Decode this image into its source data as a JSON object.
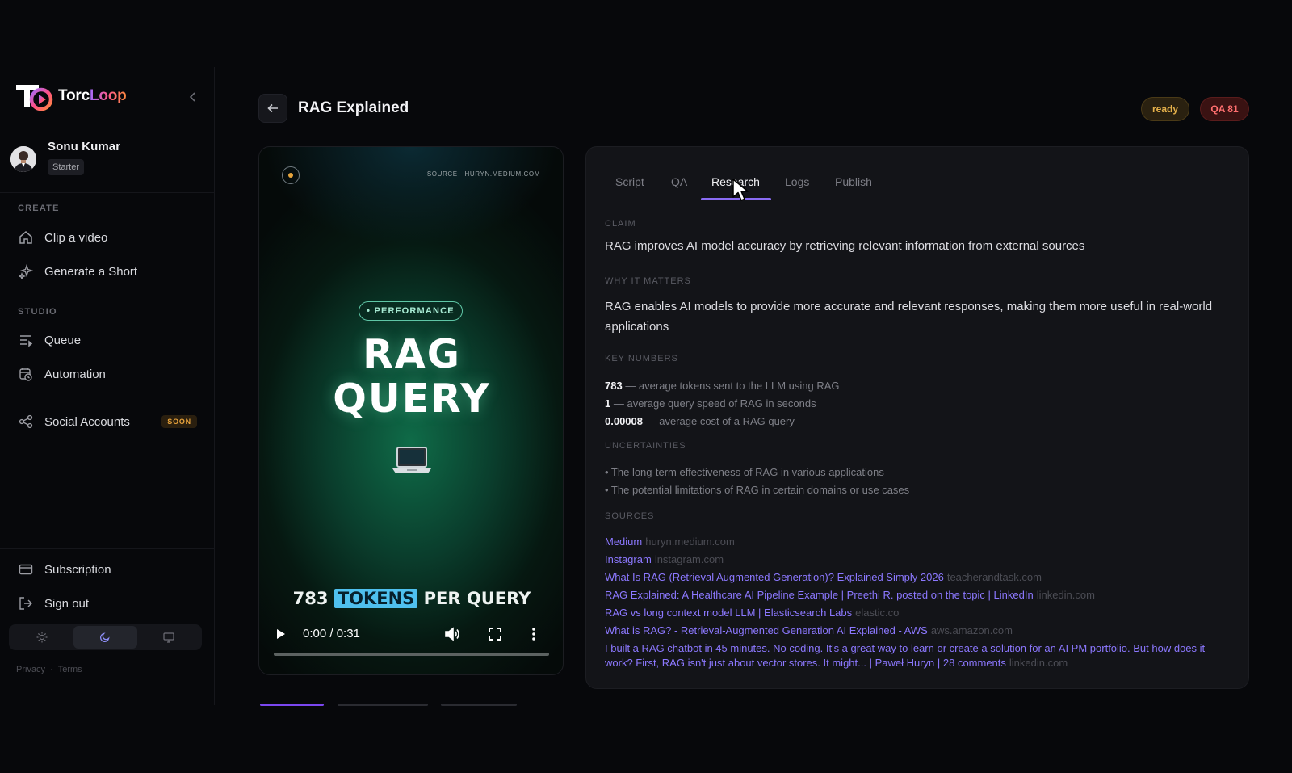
{
  "brand": {
    "part1": "Torc",
    "part2": "Loop",
    "logo_icon": "torcloop-logo-icon",
    "collapse_icon": "chevron-left-icon"
  },
  "user": {
    "name": "Sonu Kumar",
    "plan": "Starter",
    "avatar_icon": "user-avatar-icon"
  },
  "sidebar": {
    "create_label": "CREATE",
    "create_items": [
      {
        "label": "Clip a video",
        "icon": "home-icon"
      },
      {
        "label": "Generate a Short",
        "icon": "sparkles-icon"
      }
    ],
    "studio_label": "STUDIO",
    "studio_items": [
      {
        "label": "Queue",
        "icon": "queue-list-icon"
      },
      {
        "label": "Automation",
        "icon": "calendar-clock-icon"
      }
    ],
    "social": {
      "label": "Social Accounts",
      "badge": "SOON",
      "icon": "share-icon"
    },
    "bottom_items": [
      {
        "label": "Subscription",
        "icon": "credit-card-icon"
      },
      {
        "label": "Sign out",
        "icon": "sign-out-icon"
      }
    ],
    "theme_options": [
      {
        "icon": "sun-icon",
        "active": false
      },
      {
        "icon": "moon-icon",
        "active": true
      },
      {
        "icon": "monitor-icon",
        "active": false
      }
    ],
    "legal": {
      "privacy": "Privacy",
      "separator": "·",
      "terms": "Terms"
    }
  },
  "header": {
    "title": "RAG Explained",
    "status_badge": "ready",
    "qa_badge": "QA 81",
    "back_icon": "arrow-left-icon"
  },
  "video": {
    "source": "SOURCE · HURYN.MEDIUM.COM",
    "tag": "• PERFORMANCE",
    "headline_line1": "RAG",
    "headline_line2": "QUERY",
    "emoji_icon": "laptop-icon",
    "caption_number": "783",
    "caption_highlight": "TOKENS",
    "caption_rest": "PER QUERY",
    "time": "0:00 / 0:31",
    "progress": 0.0,
    "controls": [
      "play-icon",
      "volume-icon",
      "fullscreen-icon",
      "more-vertical-icon"
    ]
  },
  "tabs": [
    {
      "label": "Script",
      "active": false
    },
    {
      "label": "QA",
      "active": false
    },
    {
      "label": "Research",
      "active": true
    },
    {
      "label": "Logs",
      "active": false
    },
    {
      "label": "Publish",
      "active": false
    }
  ],
  "research": {
    "claim_label": "CLAIM",
    "claim": "RAG improves AI model accuracy by retrieving relevant information from external sources",
    "why_label": "WHY IT MATTERS",
    "why": "RAG enables AI models to provide more accurate and relevant responses, making them more useful in real-world applications",
    "key_numbers_label": "KEY NUMBERS",
    "key_numbers": [
      {
        "value": "783",
        "desc": " — average tokens sent to the LLM using RAG"
      },
      {
        "value": "1",
        "desc": " — average query speed of RAG in seconds"
      },
      {
        "value": "0.00008",
        "desc": " — average cost of a RAG query"
      }
    ],
    "uncertainties_label": "UNCERTAINTIES",
    "uncertainties": [
      "• The long-term effectiveness of RAG in various applications",
      "• The potential limitations of RAG in certain domains or use cases"
    ],
    "sources_label": "SOURCES",
    "sources": [
      {
        "title": "Medium",
        "domain": "huryn.medium.com"
      },
      {
        "title": "Instagram",
        "domain": "instagram.com"
      },
      {
        "title": "What Is RAG (Retrieval Augmented Generation)? Explained Simply 2026",
        "domain": "teacherandtask.com"
      },
      {
        "title": "RAG Explained: A Healthcare AI Pipeline Example | Preethi R. posted on the topic | LinkedIn",
        "domain": "linkedin.com"
      },
      {
        "title": "RAG vs long context model LLM | Elasticsearch Labs",
        "domain": "elastic.co"
      },
      {
        "title": "What is RAG? - Retrieval-Augmented Generation AI Explained - AWS",
        "domain": "aws.amazon.com"
      },
      {
        "title": "I built a RAG chatbot in 45 minutes. No coding. It's a great way to learn or create a solution for an AI PM portfolio. But how does it work? First, RAG isn't just about vector stores. It might... | Paweł Huryn | 28 comments",
        "domain": "linkedin.com"
      }
    ]
  },
  "colors": {
    "accent": "#8a6cf3",
    "ready": "#e4b04a",
    "qa": "#ff6f6f",
    "highlight": "#4fc0ee"
  },
  "cursor_icon": "mouse-pointer-icon"
}
